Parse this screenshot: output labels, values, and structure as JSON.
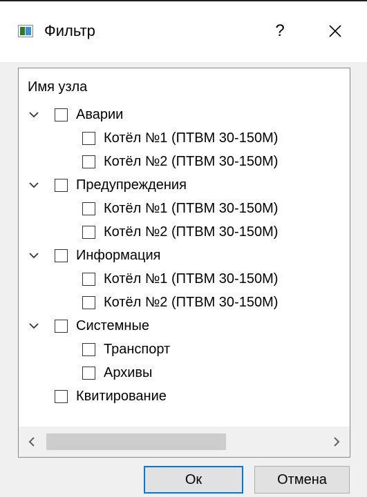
{
  "window": {
    "title": "Фильтр",
    "help_label": "?",
    "icons": {
      "app": "app-window-icon",
      "close": "close-icon"
    }
  },
  "tree": {
    "header": "Имя узла",
    "groups": [
      {
        "label": "Аварии",
        "expanded": true,
        "checked": false,
        "children": [
          {
            "label": "Котёл №1 (ПТВМ 30-150М)",
            "checked": false
          },
          {
            "label": "Котёл №2 (ПТВМ 30-150М)",
            "checked": false
          }
        ]
      },
      {
        "label": "Предупреждения",
        "expanded": true,
        "checked": false,
        "children": [
          {
            "label": "Котёл №1 (ПТВМ 30-150М)",
            "checked": false
          },
          {
            "label": "Котёл №2 (ПТВМ 30-150М)",
            "checked": false
          }
        ]
      },
      {
        "label": "Информация",
        "expanded": true,
        "checked": false,
        "children": [
          {
            "label": "Котёл №1 (ПТВМ 30-150М)",
            "checked": false
          },
          {
            "label": "Котёл №2 (ПТВМ 30-150М)",
            "checked": false
          }
        ]
      },
      {
        "label": "Системные",
        "expanded": true,
        "checked": false,
        "children": [
          {
            "label": "Транспорт",
            "checked": false
          },
          {
            "label": "Архивы",
            "checked": false
          }
        ]
      },
      {
        "label": "Квитирование",
        "expanded": false,
        "checked": false,
        "children": []
      }
    ],
    "scrollbar": {
      "left_icon": "chevron-left-icon",
      "right_icon": "chevron-right-icon"
    }
  },
  "buttons": {
    "ok_label": "Ок",
    "cancel_label": "Отмена"
  },
  "colors": {
    "accent": "#0078d7",
    "dialog_bg": "#f0f0f0",
    "button_bg": "#e1e1e1",
    "scroll_thumb": "#cdcdcd"
  }
}
